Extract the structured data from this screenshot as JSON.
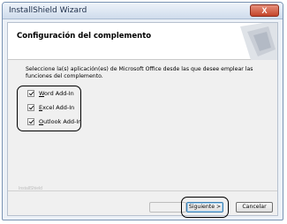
{
  "window": {
    "title": "InstallShield Wizard",
    "close_label": "X"
  },
  "banner": {
    "title": "Configuración del complemento"
  },
  "description": "Seleccione la(s) aplicación(es) de Microsoft Office desde las que desee emplear las funciones del complemento.",
  "addins": [
    {
      "hotkey": "W",
      "rest": "ord Add-In",
      "checked": true
    },
    {
      "hotkey": "E",
      "rest": "xcel Add-In",
      "checked": true
    },
    {
      "hotkey": "O",
      "rest": "utlook Add-In",
      "checked": true
    }
  ],
  "footer": {
    "brand": "InstallShield"
  },
  "buttons": {
    "back": "",
    "next": "Siguiente >",
    "cancel": "Cancelar"
  },
  "colors": {
    "close_button": "#c4452a",
    "highlight": "#000000"
  }
}
